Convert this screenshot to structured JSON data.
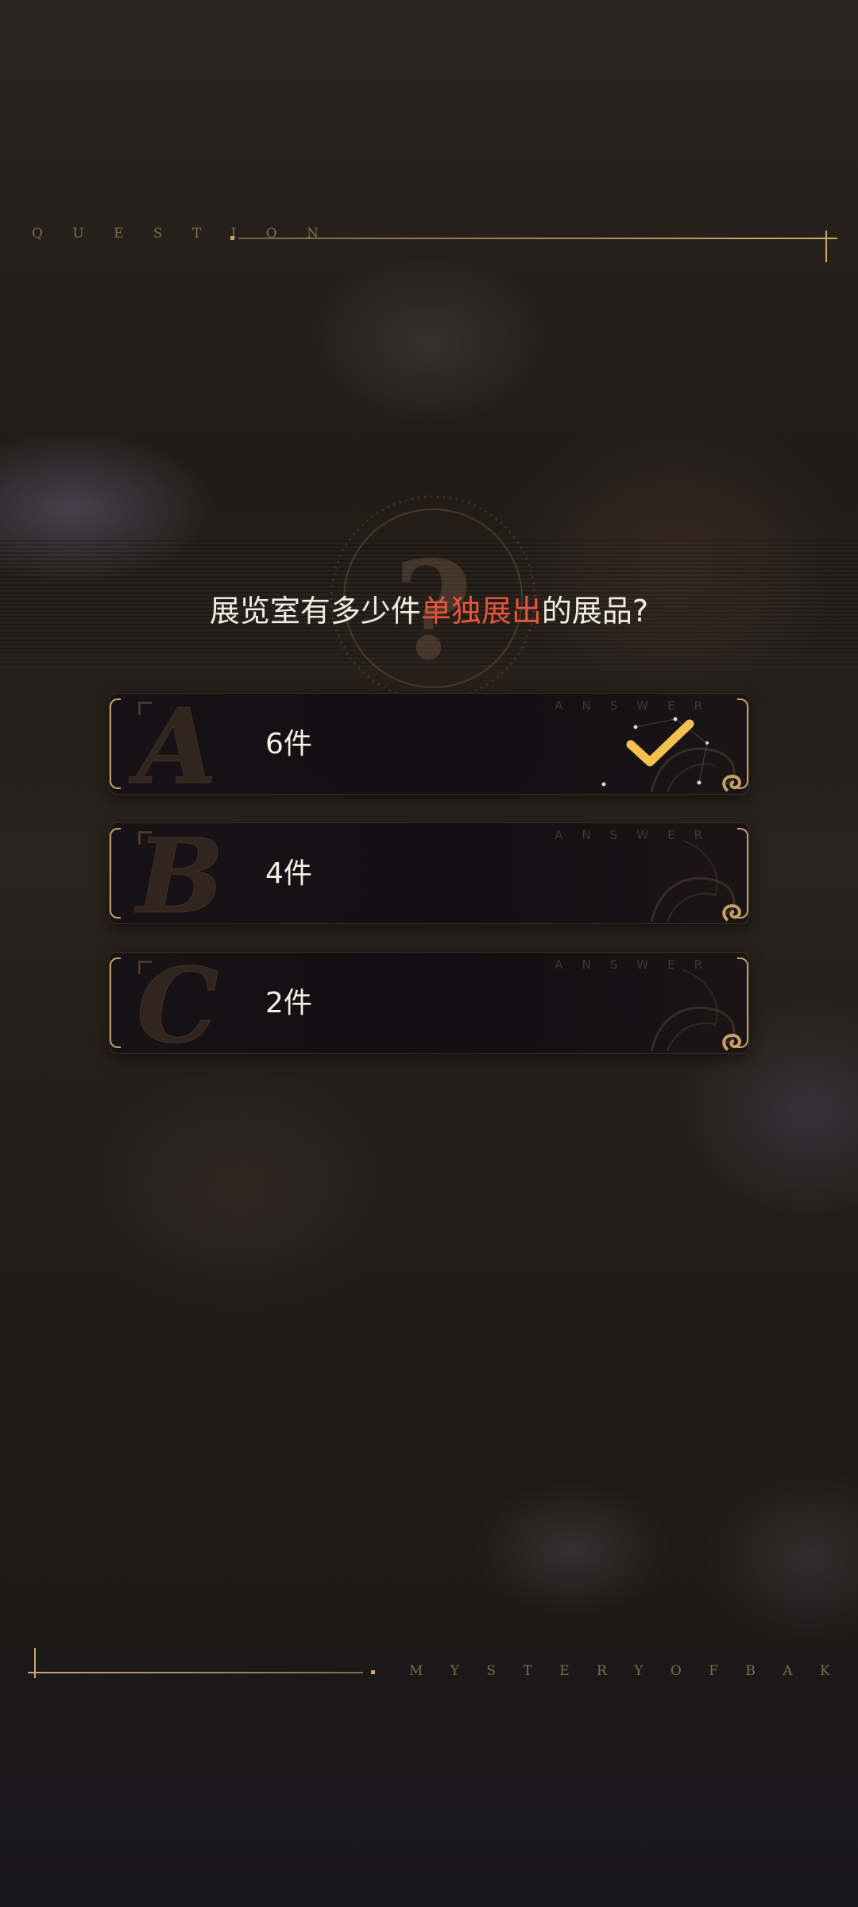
{
  "header": {
    "label": "Q U E S T I O N"
  },
  "question": {
    "prefix": "展览室有多少件",
    "highlight": "单独展出",
    "suffix": "的展品?"
  },
  "options": [
    {
      "letter": "A",
      "text": "6件",
      "answer_label": "ANSWER",
      "selected": true
    },
    {
      "letter": "B",
      "text": "4件",
      "answer_label": "ANSWER",
      "selected": false
    },
    {
      "letter": "C",
      "text": "2件",
      "answer_label": "ANSWER",
      "selected": false
    }
  ],
  "footer": {
    "label": "M Y S T E R Y   O F   B A K E R L O N"
  },
  "colors": {
    "accent_gold": "#c9a86a",
    "highlight_red": "#e4553c",
    "check_yellow": "#f2c24e",
    "text_light": "#f1ece4"
  },
  "icons": {
    "emblem": "question-mark-emblem-icon",
    "check": "checkmark-icon",
    "corner": "swirl-ornament-icon"
  }
}
